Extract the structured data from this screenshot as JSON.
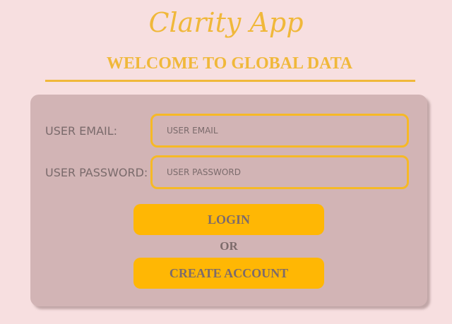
{
  "app": {
    "logo_text": "Clarity App",
    "welcome_heading": "WELCOME TO GLOBAL DATA"
  },
  "form": {
    "email_label": "USER EMAIL:",
    "email_placeholder": "USER EMAIL",
    "email_value": "",
    "password_label": "USER PASSWORD:",
    "password_placeholder": "USER PASSWORD",
    "password_value": "",
    "login_label": "LOGIN",
    "or_text": "OR",
    "create_account_label": "CREATE ACCOUNT"
  },
  "colors": {
    "page_background": "#f7dfe0",
    "card_background": "#d2b4b5",
    "accent": "#f0b83a",
    "button": "#ffb704",
    "text": "#7a6a6b"
  }
}
